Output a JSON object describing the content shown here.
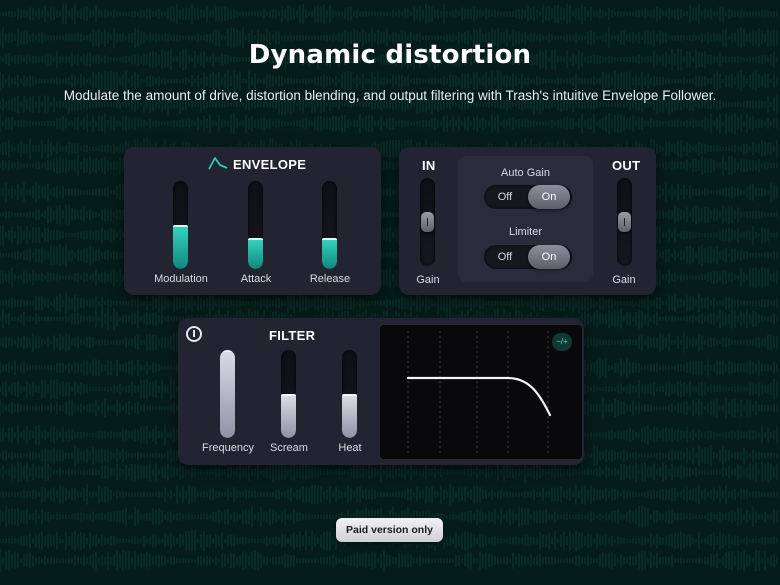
{
  "hero": {
    "title": "Dynamic distortion",
    "subtitle": "Modulate the amount of drive, distortion blending, and output filtering with Trash's intuitive Envelope Follower."
  },
  "envelope": {
    "title": "ENVELOPE",
    "icon": "envelope-curve-icon",
    "sliders": [
      {
        "label": "Modulation",
        "level": 0.5
      },
      {
        "label": "Attack",
        "level": 0.35
      },
      {
        "label": "Release",
        "level": 0.35
      }
    ]
  },
  "io": {
    "in_title": "IN",
    "out_title": "OUT",
    "in_gain_label": "Gain",
    "out_gain_label": "Gain",
    "auto_gain": {
      "label": "Auto Gain",
      "off": "Off",
      "on": "On",
      "selected": "On"
    },
    "limiter": {
      "label": "Limiter",
      "off": "Off",
      "on": "On",
      "selected": "On"
    }
  },
  "filter": {
    "title": "FILTER",
    "power_icon": "power-icon",
    "sliders": [
      {
        "label": "Frequency",
        "level": 1.0
      },
      {
        "label": "Scream",
        "level": 0.5
      },
      {
        "label": "Heat",
        "level": 0.5
      }
    ],
    "graph_badge": "−/+"
  },
  "cta": {
    "label": "Paid version only"
  },
  "colors": {
    "accent_teal": "#2fc9b6",
    "panel_bg": "#222431",
    "page_bg": "#07241f"
  }
}
